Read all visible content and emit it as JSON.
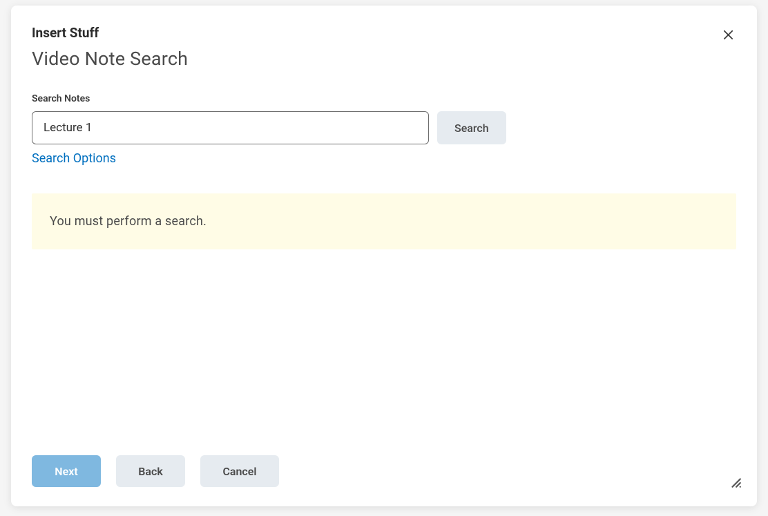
{
  "modal": {
    "title": "Insert Stuff",
    "subtitle": "Video Note Search",
    "close_label": "Close"
  },
  "search": {
    "label": "Search Notes",
    "value": "Lecture 1",
    "button_label": "Search",
    "options_link": "Search Options"
  },
  "banner": {
    "message": "You must perform a search."
  },
  "footer": {
    "next_label": "Next",
    "back_label": "Back",
    "cancel_label": "Cancel"
  }
}
